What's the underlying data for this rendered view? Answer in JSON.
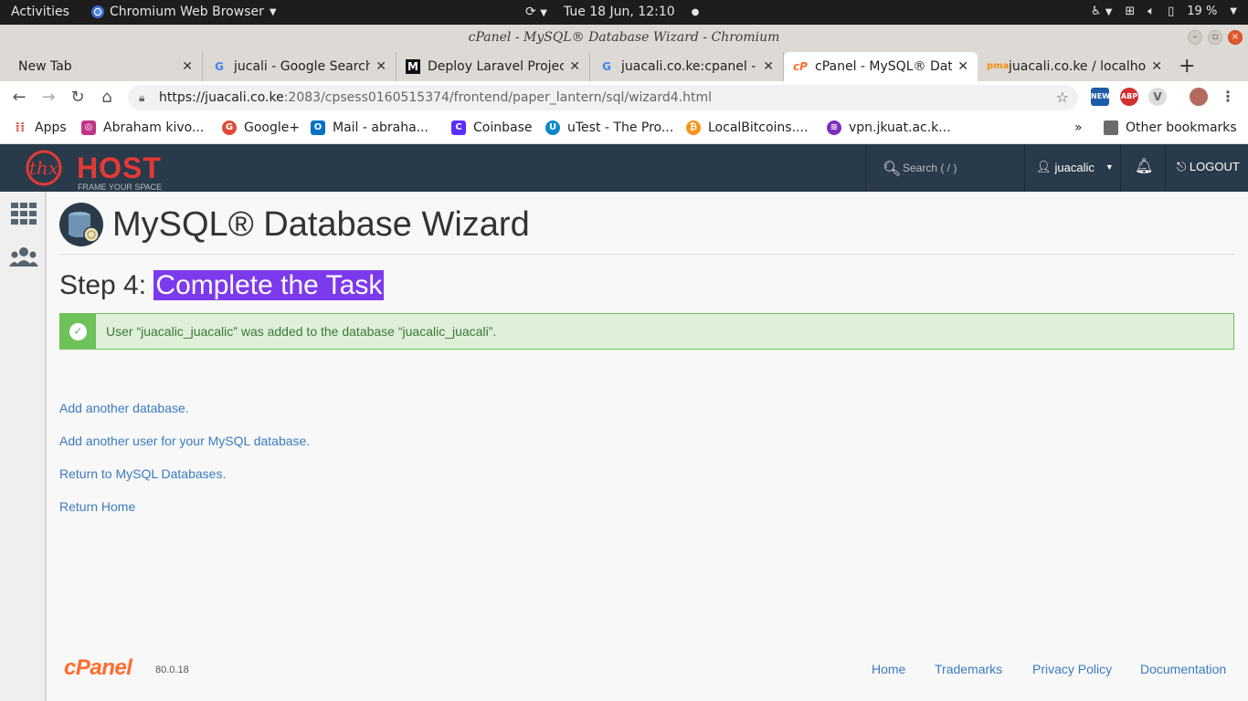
{
  "os_bar": {
    "activities": "Activities",
    "app_menu": "Chromium Web Browser",
    "datetime": "Tue 18 Jun, 12:10",
    "battery": "19 %"
  },
  "window": {
    "title": "cPanel - MySQL® Database Wizard - Chromium"
  },
  "tabs": [
    {
      "label": "New Tab",
      "icon": "none"
    },
    {
      "label": "jucali - Google Search",
      "icon": "google-icon"
    },
    {
      "label": "Deploy Laravel Projec",
      "icon": "medium-icon"
    },
    {
      "label": "juacali.co.ke:cpanel - G",
      "icon": "google-icon"
    },
    {
      "label": "cPanel - MySQL® Data",
      "icon": "cpanel-icon",
      "active": true
    },
    {
      "label": "juacali.co.ke / localho",
      "icon": "phpmyadmin-icon"
    }
  ],
  "address": {
    "url_host": "https://juacali.co.ke",
    "url_rest": ":2083/cpsess0160515374/frontend/paper_lantern/sql/wizard4.html"
  },
  "bookmarks": [
    {
      "label": "Apps",
      "color": "#e8453c"
    },
    {
      "label": "Abraham kivo...",
      "color": "#c13584"
    },
    {
      "label": "Google+",
      "color": "#dd4b39"
    },
    {
      "label": "Mail - abraha...",
      "color": "#0072c6"
    },
    {
      "label": "Coinbase",
      "color": "#5b2eff"
    },
    {
      "label": "uTest - The Pro...",
      "color": "#0b88c8"
    },
    {
      "label": "LocalBitcoins....",
      "color": "#f7931a"
    },
    {
      "label": "vpn.jkuat.ac.k...",
      "color": "#7b2fbf"
    }
  ],
  "bookmarks_overflow": "»",
  "other_bookmarks": "Other bookmarks",
  "cpanel": {
    "brand": "HOST",
    "brand_mark": "thx",
    "tagline": "FRAME YOUR SPACE",
    "search_placeholder": "Search ( / )",
    "username": "juacalic",
    "logout": "LOGOUT"
  },
  "page": {
    "title": "MySQL® Database Wizard",
    "step_prefix": "Step 4: ",
    "step_title": "Complete the Task",
    "alert": "User “juacalic_juacalic” was added to the database “juacalic_juacali”.",
    "links": [
      "Add another database.",
      "Add another user for your MySQL database.",
      "Return to MySQL Databases.",
      "Return Home"
    ]
  },
  "footer": {
    "logo": "cPanel",
    "version": "80.0.18",
    "links": [
      "Home",
      "Trademarks",
      "Privacy Policy",
      "Documentation"
    ]
  },
  "colors": {
    "header_bg": "#293a4a",
    "brand_red": "#e53935",
    "step_highlight": "#7c3aed",
    "success_green": "#6ec25a",
    "link_blue": "#3a7ac0",
    "cpanel_orange": "#ff6c2c"
  }
}
